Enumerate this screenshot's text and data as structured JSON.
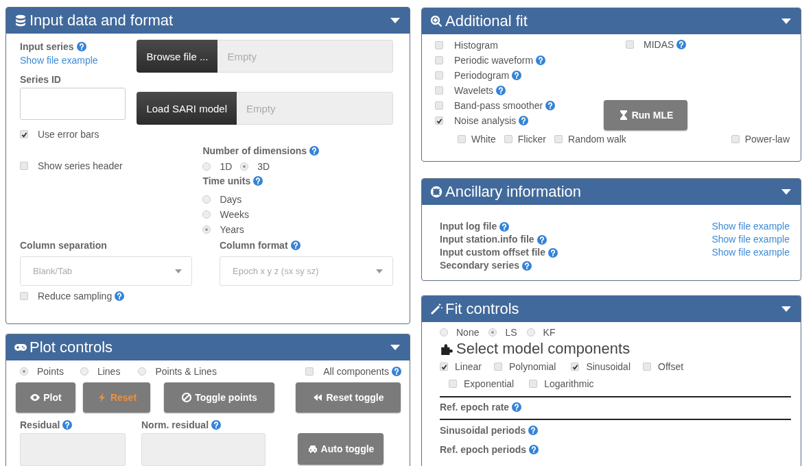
{
  "input_panel": {
    "title": "Input data and format",
    "input_series": {
      "label": "Input series",
      "help": true,
      "link": "Show file example"
    },
    "series_id": {
      "label": "Series ID"
    },
    "browse": {
      "button": "Browse file ...",
      "placeholder": "Empty"
    },
    "sari": {
      "button": "Load SARI model",
      "placeholder": "Empty"
    },
    "options": [
      {
        "label": "Use error bars",
        "checked": true
      },
      {
        "label": "Show series header",
        "checked": false
      }
    ],
    "dimensions": {
      "label": "Number of dimensions",
      "help": true,
      "choices": [
        {
          "label": "1D",
          "selected": false
        },
        {
          "label": "3D",
          "selected": true
        }
      ]
    },
    "time_units": {
      "label": "Time units",
      "help": true,
      "choices": [
        {
          "label": "Days",
          "selected": false
        },
        {
          "label": "Weeks",
          "selected": false
        },
        {
          "label": "Years",
          "selected": true
        }
      ]
    },
    "column_separation": {
      "label": "Column separation",
      "help": false,
      "value": "Blank/Tab"
    },
    "column_format": {
      "label": "Column format",
      "help": true,
      "value": "Epoch x y z (sx sy sz)"
    },
    "reduce_sampling": {
      "label": "Reduce sampling",
      "help": true,
      "checked": false
    }
  },
  "plot_panel": {
    "title": "Plot controls",
    "modes": [
      {
        "label": "Points",
        "selected": true
      },
      {
        "label": "Lines",
        "selected": false
      },
      {
        "label": "Points & Lines",
        "selected": false
      }
    ],
    "all_components": {
      "label": "All components",
      "help": true,
      "checked": false
    },
    "buttons": {
      "plot": "Plot",
      "reset": "Reset",
      "toggle_points": "Toggle points",
      "reset_toggle": "Reset toggle",
      "auto_toggle": "Auto toggle"
    },
    "residual": {
      "label": "Residual",
      "help": true
    },
    "norm_residual": {
      "label": "Norm. residual",
      "help": true
    }
  },
  "additional_fit_panel": {
    "title": "Additional fit",
    "options": [
      {
        "label": "Histogram",
        "help": false,
        "checked": false
      },
      {
        "label": "Periodic waveform",
        "help": true,
        "checked": false
      },
      {
        "label": "Periodogram",
        "help": true,
        "checked": false
      },
      {
        "label": "Wavelets",
        "help": true,
        "checked": false
      },
      {
        "label": "Band-pass smoother",
        "help": true,
        "checked": false
      },
      {
        "label": "Noise analysis",
        "help": true,
        "checked": true
      }
    ],
    "midas": {
      "label": "MIDAS",
      "help": true,
      "checked": false
    },
    "run_button": "Run MLE",
    "noise_models": [
      {
        "label": "White",
        "checked": false
      },
      {
        "label": "Flicker",
        "checked": false
      },
      {
        "label": "Random walk",
        "checked": false
      },
      {
        "label": "Power-law",
        "checked": false
      }
    ]
  },
  "ancillary_panel": {
    "title": "Ancillary information",
    "rows": [
      {
        "label": "Input log file",
        "help": true,
        "link": "Show file example"
      },
      {
        "label": "Input station.info file",
        "help": true,
        "link": "Show file example"
      },
      {
        "label": "Input custom offset file",
        "help": true,
        "link": "Show file example"
      },
      {
        "label": "Secondary series",
        "help": true
      }
    ]
  },
  "fit_panel": {
    "title": "Fit controls",
    "methods": [
      {
        "label": "None",
        "selected": false
      },
      {
        "label": "LS",
        "selected": true
      },
      {
        "label": "KF",
        "selected": false
      }
    ],
    "components_heading": "Select model components",
    "components": [
      {
        "label": "Linear",
        "checked": true
      },
      {
        "label": "Polynomial",
        "checked": false
      },
      {
        "label": "Sinusoidal",
        "checked": true
      },
      {
        "label": "Offset",
        "checked": false
      },
      {
        "label": "Exponential",
        "checked": false
      },
      {
        "label": "Logarithmic",
        "checked": false
      }
    ],
    "ref_epoch_rate": {
      "label": "Ref. epoch rate",
      "help": true
    },
    "sinusoidal_periods": {
      "label": "Sinusoidal periods",
      "help": true
    },
    "ref_epoch_periods": {
      "label": "Ref. epoch periods",
      "help": true
    }
  }
}
